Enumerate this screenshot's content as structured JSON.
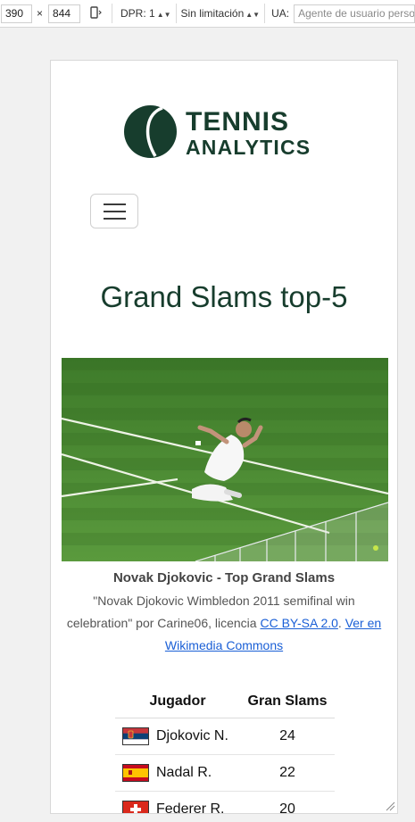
{
  "devtools": {
    "width": "390",
    "times": "×",
    "height": "844",
    "dpr_label": "DPR: 1",
    "throttle_label": "Sin limitación",
    "ua_label": "UA:",
    "ua_placeholder": "Agente de usuario personalizado"
  },
  "logo": {
    "line1": "TENNIS",
    "line2": "ANALYTICS"
  },
  "page": {
    "title": "Grand Slams top-5"
  },
  "figure": {
    "caption_title": "Novak Djokovic - Top Grand Slams",
    "caption_prefix": "\"Novak Djokovic Wimbledon 2011 semifinal win celebration\" por Carine06, licencia ",
    "license_link": "CC BY-SA 2.0",
    "separator": ". ",
    "commons_link": "Ver en Wikimedia Commons"
  },
  "table": {
    "headers": [
      "Jugador",
      "Gran Slams"
    ],
    "rows": [
      {
        "name": "Djokovic N.",
        "slams": "24",
        "flag": "serbia-flag"
      },
      {
        "name": "Nadal R.",
        "slams": "22",
        "flag": "spain-flag"
      },
      {
        "name": "Federer R.",
        "slams": "20",
        "flag": "switzerland-flag"
      }
    ]
  },
  "colors": {
    "brand": "#173d2d",
    "link": "#1a5fd6"
  }
}
